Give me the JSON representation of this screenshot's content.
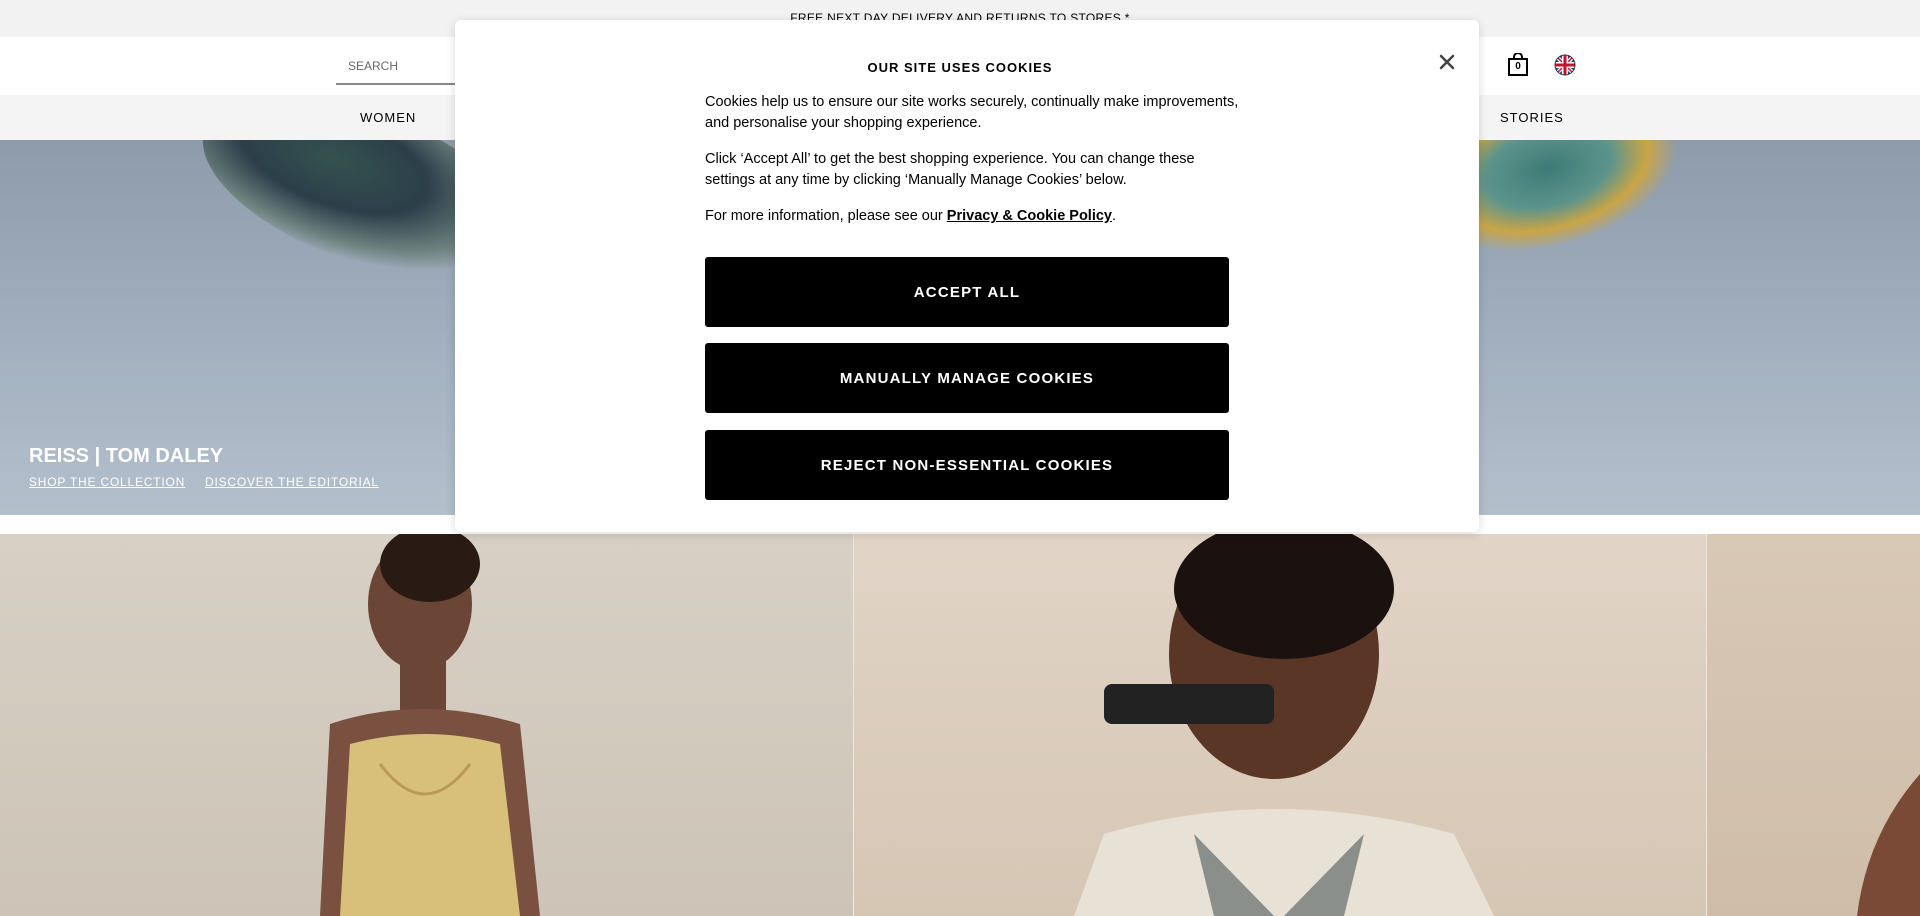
{
  "promo": {
    "text": "FREE NEXT DAY DELIVERY AND RETURNS TO STORES *"
  },
  "header": {
    "search_placeholder": "SEARCH",
    "bag_count": "0"
  },
  "nav": {
    "items": [
      "WOMEN",
      "STORIES"
    ]
  },
  "hero": {
    "title": "REISS | TOM DALEY",
    "links": [
      "SHOP THE COLLECTION",
      "DISCOVER THE EDITORIAL"
    ]
  },
  "cookie_modal": {
    "title": "OUR SITE USES COOKIES",
    "paragraph_1": "Cookies help us to ensure our site works securely, continually make improvements, and personalise your shopping experience.",
    "paragraph_2": "Click ‘Accept All’ to get the best shopping experience. You can change these settings at any time by clicking ‘Manually Manage Cookies’ below.",
    "paragraph_3_prefix": "For more information, please see our ",
    "policy_link": "Privacy & Cookie Policy",
    "paragraph_3_suffix": ".",
    "accept_all": "ACCEPT ALL",
    "manage": "MANUALLY MANAGE COOKIES",
    "reject": "REJECT NON-ESSENTIAL COOKIES"
  },
  "colors": {
    "button_bg": "#000000",
    "promo_bg": "#f2f2f2",
    "nav_bg": "#f4f4f4"
  },
  "icons": [
    "search-icon",
    "bag-icon",
    "uk-flag-icon",
    "close-icon"
  ]
}
